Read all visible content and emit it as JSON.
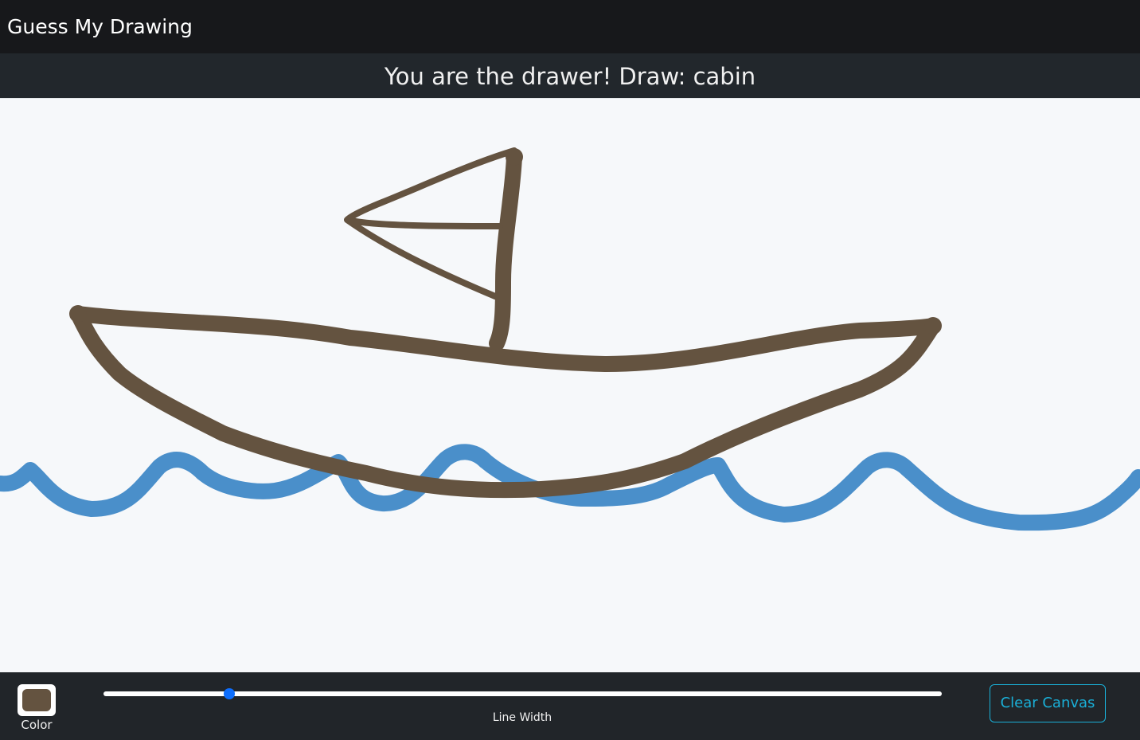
{
  "header": {
    "brand": "Guess My Drawing"
  },
  "prompt": {
    "text": "You are the drawer! Draw: cabin"
  },
  "toolbar": {
    "color_label": "Color",
    "selected_color": "#645340",
    "line_width_label": "Line Width",
    "line_width_fraction": 0.15,
    "clear_label": "Clear Canvas",
    "accent_color": "#1ab0d8"
  },
  "canvas": {
    "background": "#f6f8fa",
    "stroke_colors": {
      "boat": "#645340",
      "water": "#4a8fca"
    }
  }
}
